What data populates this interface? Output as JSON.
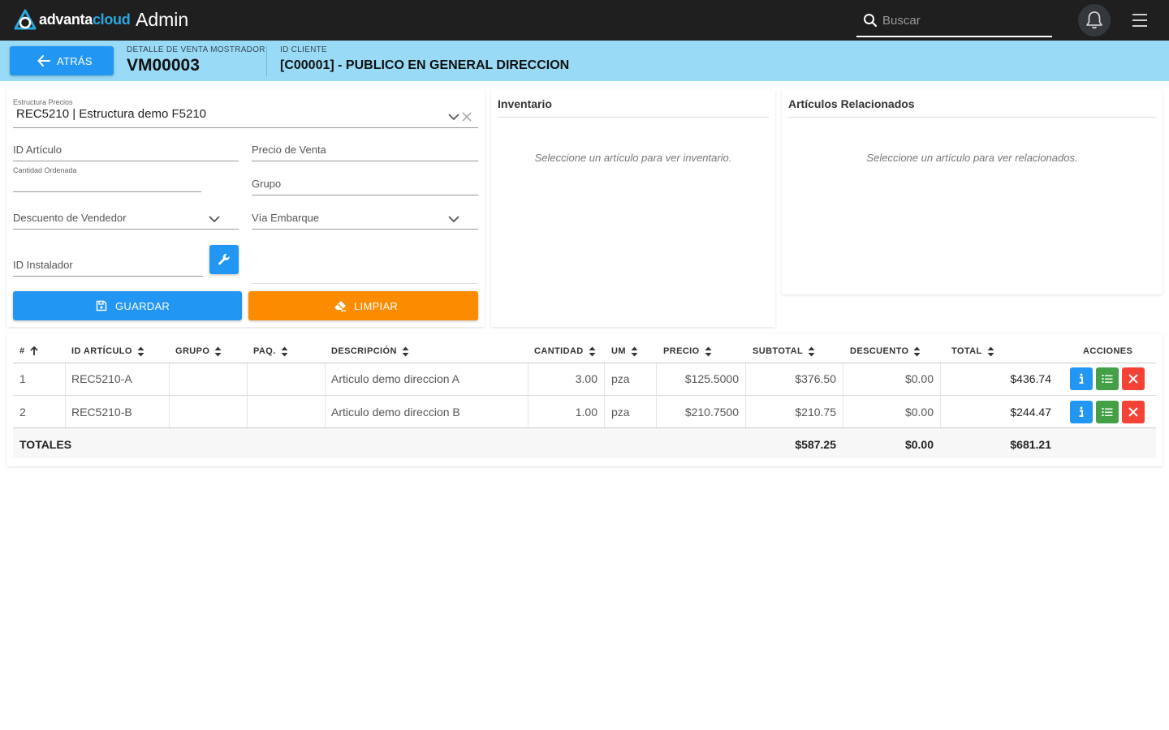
{
  "topbar": {
    "brand_part1": "advanta",
    "brand_part2": "cloud",
    "app_title": "Admin",
    "search_placeholder": "Buscar",
    "icons": [
      "search-icon",
      "bell-icon",
      "hamburger-menu-icon"
    ]
  },
  "header": {
    "back_label": "ATRÁS",
    "sale_label": "DETALLE DE VENTA MOSTRADOR",
    "sale_value": "VM00003",
    "client_label": "ID CLIENTE",
    "client_value": "[C00001] - PUBLICO EN GENERAL DIRECCION"
  },
  "form": {
    "price_structure_label": "Estructura Precios",
    "price_structure_value": "REC5210 | Estructura demo F5210",
    "article_id_label": "ID Artículo",
    "sale_price_label": "Precio de Venta",
    "qty_label": "Cantidad Ordenada",
    "group_label": "Grupo",
    "seller_discount_label": "Descuento de Vendedor",
    "shipping_label": "Vía Embarque",
    "installer_label": "ID Instalador",
    "save_label": "GUARDAR",
    "clear_label": "LIMPIAR"
  },
  "inventory": {
    "title": "Inventario",
    "empty": "Seleccione un artículo para ver inventario."
  },
  "related": {
    "title": "Artículos Relacionados",
    "empty": "Seleccione un artículo para ver relacionados."
  },
  "table": {
    "headers": {
      "num": "#",
      "article": "ID ARTÍCULO",
      "group": "GRUPO",
      "pack": "PAQ.",
      "description": "DESCRIPCIÓN",
      "qty": "CANTIDAD",
      "um": "UM",
      "price": "PRECIO",
      "subtotal": "SUBTOTAL",
      "discount": "DESCUENTO",
      "total": "TOTAL",
      "actions": "ACCIONES"
    },
    "rows": [
      {
        "num": "1",
        "article": "REC5210-A",
        "group": "",
        "pack": "",
        "description": "Articulo demo direccion A",
        "qty": "3.00",
        "um": "pza",
        "price": "$125.5000",
        "subtotal": "$376.50",
        "discount": "$0.00",
        "total": "$436.74"
      },
      {
        "num": "2",
        "article": "REC5210-B",
        "group": "",
        "pack": "",
        "description": "Articulo demo direccion B",
        "qty": "1.00",
        "um": "pza",
        "price": "$210.7500",
        "subtotal": "$210.75",
        "discount": "$0.00",
        "total": "$244.47"
      }
    ],
    "totals": {
      "label": "TOTALES",
      "subtotal": "$587.25",
      "discount": "$0.00",
      "total": "$681.21"
    }
  },
  "colors": {
    "topbar": "#1f1f1f",
    "header_bg": "#99dbf7",
    "primary": "#2196f3",
    "orange": "#fb8c00",
    "green": "#43a047",
    "red": "#f44336"
  }
}
